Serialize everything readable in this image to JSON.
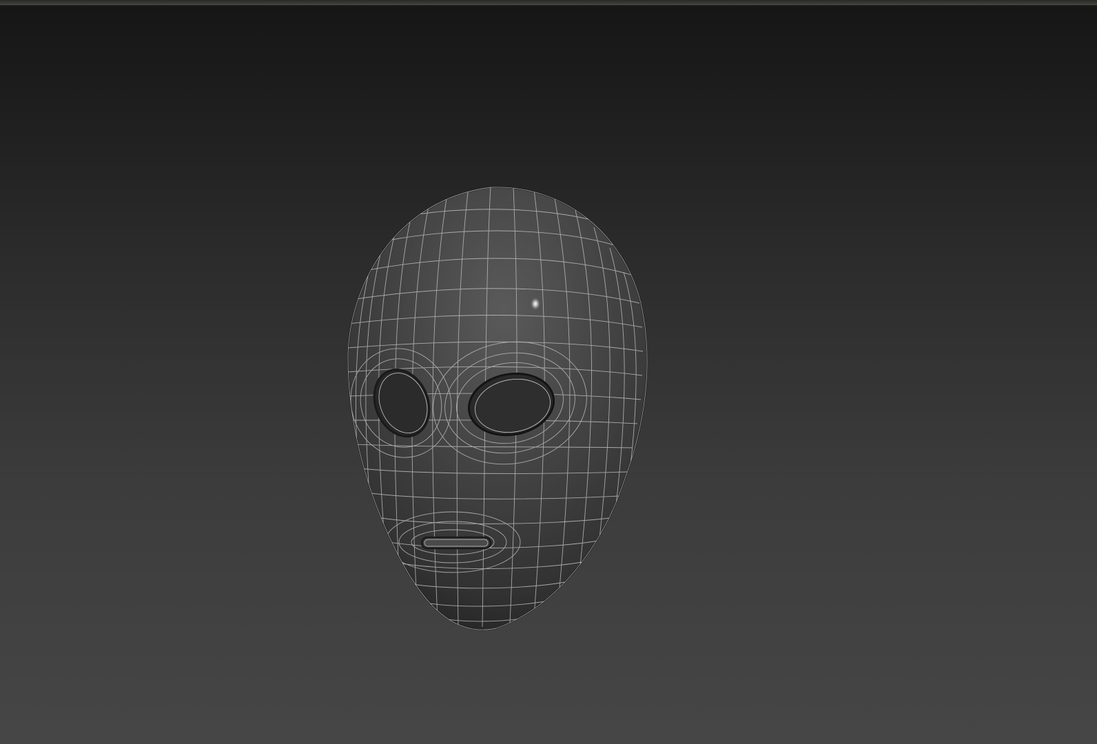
{
  "viewport": {
    "background_top_color": "#161616",
    "background_bottom_color": "#464646",
    "top_edge_color": "#4a4940"
  },
  "object": {
    "name_semantic": "mask-mesh",
    "shading": "wireframe-on-shaded",
    "surface_color": "#3a3a3a",
    "wire_color": "#b8b8b8",
    "highlight_color": "#ffffff"
  }
}
